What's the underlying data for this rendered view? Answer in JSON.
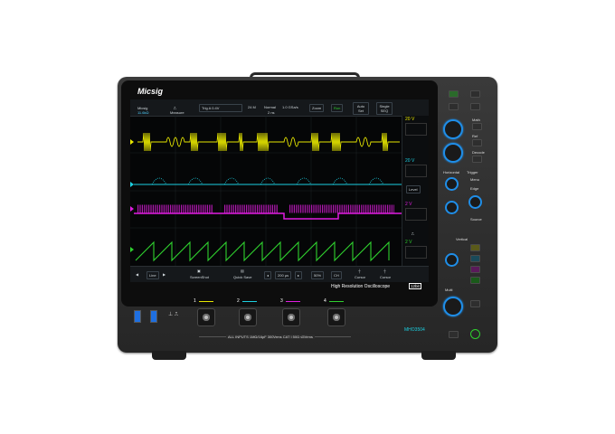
{
  "brand": "Micsig",
  "model_badge": "High Resolution Oscilloscope",
  "bit_badge": "12bit",
  "model": "MHO3504",
  "inputs_note": "ALL INPUTS 1MΩ/16pF 300Vrms CAT I  50Ω ≤5Vrms",
  "channels": [
    {
      "label": "1",
      "color": "#e6e600"
    },
    {
      "label": "2",
      "color": "#1ccfe0"
    },
    {
      "label": "3",
      "color": "#e01de0"
    },
    {
      "label": "4",
      "color": "#2fd02f"
    }
  ],
  "screen": {
    "top": {
      "freq": "11.6kΩ",
      "measure": "Measure",
      "trig": "Trig A  0.4V",
      "mem": "24 M",
      "mode": "Normal",
      "rate": "1.0 GSa/s",
      "time": "2 ns",
      "zoom": "Zoom",
      "run": "Run",
      "auto": "Auto Set",
      "single": "Single SEQ"
    },
    "right": {
      "ch1_scale": "20 V",
      "ch2_scale": "20 V",
      "ch3_scale": "2 V",
      "ch4_scale": "2 V",
      "level": "Level"
    },
    "bottom": {
      "menu": "Line",
      "screenshot": "ScreenShot",
      "quick_save": "Quick Save",
      "time_div": "200 µs",
      "zoom_pct": "50%",
      "ch": "CH",
      "cursor1": "Cursor",
      "cursor2": "Cursor"
    }
  },
  "panel": {
    "math": "Math",
    "ref": "Ref",
    "decode": "Decode",
    "horizontal": "Horizontal",
    "trigger": "Trigger",
    "vertical": "Vertical",
    "menu": "Menu",
    "edge": "Edge",
    "position": "Position",
    "scale": "Scale",
    "level": "Level",
    "source": "Source",
    "multi": "Multi"
  }
}
